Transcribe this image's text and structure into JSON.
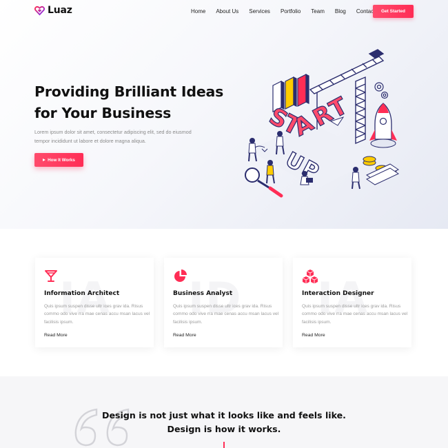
{
  "brand": {
    "name": "Luaz",
    "logo_icon": "heart-gem-icon",
    "accent": "#ff2d55"
  },
  "nav": {
    "items": [
      "Home",
      "About Us",
      "Services",
      "Portfolio",
      "Team",
      "Blog",
      "Contact Us"
    ],
    "cta": "Get Started"
  },
  "hero": {
    "title_line1": "Providing Brilliant Ideas",
    "title_line2": "for Your Business",
    "text": "Lorem ipsum dolor sit amet, consectetur adipiscing elit, sed do eiusmod tempor incididunt ut labore et dolore magna aliqua.",
    "button": "How It Works",
    "illustration": "startup-isometric-illustration"
  },
  "features": [
    {
      "icon": "cocktail-glass-icon",
      "ghost": "IA",
      "title": "Information Architect",
      "text": "Quis ipsum suspen disse ultr ices grav ida. Risus commo odo vive rra mae cenas accu msan lacus vel facilisis ipsum.",
      "link": "Read More"
    },
    {
      "icon": "pie-chart-icon",
      "ghost": "ID",
      "title": "Business Analyst",
      "text": "Quis ipsum suspen disse ultr ices grav ida. Risus commo odo vive rra mae cenas accu msan lacus vel facilisis ipsum.",
      "link": "Read More"
    },
    {
      "icon": "cubes-icon",
      "ghost": "IA",
      "title": "Interaction Designer",
      "text": "Quis ipsum suspen disse ultr ices grav ida. Risus commo odo vive rra mae cenas accu msan lacus vel facilisis ipsum.",
      "link": "Read More"
    }
  ],
  "quote": {
    "line1": "Design is not just what it looks like and feels like.",
    "line2": "Design is how it works."
  }
}
